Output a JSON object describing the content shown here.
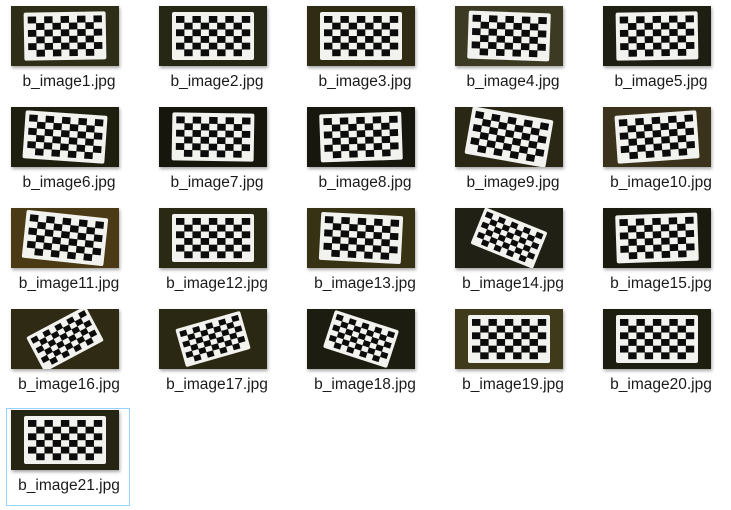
{
  "files": [
    {
      "name": "b_image1.jpg",
      "icon": "checkerboard-thumbnail-icon",
      "bg": "#2e2d17",
      "tilt": -1,
      "selected": false
    },
    {
      "name": "b_image2.jpg",
      "icon": "checkerboard-thumbnail-icon",
      "bg": "#272716",
      "tilt": 0,
      "selected": false
    },
    {
      "name": "b_image3.jpg",
      "icon": "checkerboard-thumbnail-icon",
      "bg": "#302c14",
      "tilt": 0,
      "selected": false
    },
    {
      "name": "b_image4.jpg",
      "icon": "checkerboard-thumbnail-icon",
      "bg": "#3c3a22",
      "tilt": 2,
      "selected": false
    },
    {
      "name": "b_image5.jpg",
      "icon": "checkerboard-thumbnail-icon",
      "bg": "#1e1e12",
      "tilt": -1,
      "selected": false
    },
    {
      "name": "b_image6.jpg",
      "icon": "checkerboard-thumbnail-icon",
      "bg": "#1f1f10",
      "tilt": 4,
      "selected": false
    },
    {
      "name": "b_image7.jpg",
      "icon": "checkerboard-thumbnail-icon",
      "bg": "#16160c",
      "tilt": 1,
      "selected": false
    },
    {
      "name": "b_image8.jpg",
      "icon": "checkerboard-thumbnail-icon",
      "bg": "#18170e",
      "tilt": -2,
      "selected": false
    },
    {
      "name": "b_image9.jpg",
      "icon": "checkerboard-thumbnail-icon",
      "bg": "#2a2814",
      "tilt": 10,
      "selected": false
    },
    {
      "name": "b_image10.jpg",
      "icon": "checkerboard-thumbnail-icon",
      "bg": "#3a321a",
      "tilt": -4,
      "selected": false
    },
    {
      "name": "b_image11.jpg",
      "icon": "checkerboard-thumbnail-icon",
      "bg": "#4a3a16",
      "tilt": 6,
      "selected": false
    },
    {
      "name": "b_image12.jpg",
      "icon": "checkerboard-thumbnail-icon",
      "bg": "#2a2a14",
      "tilt": 0,
      "selected": false
    },
    {
      "name": "b_image13.jpg",
      "icon": "checkerboard-thumbnail-icon",
      "bg": "#383214",
      "tilt": 3,
      "selected": false
    },
    {
      "name": "b_image14.jpg",
      "icon": "checkerboard-thumbnail-icon",
      "bg": "#202014",
      "tilt": 22,
      "selected": false
    },
    {
      "name": "b_image15.jpg",
      "icon": "checkerboard-thumbnail-icon",
      "bg": "#1a1a0e",
      "tilt": -2,
      "selected": false
    },
    {
      "name": "b_image16.jpg",
      "icon": "checkerboard-thumbnail-icon",
      "bg": "#2e2a14",
      "tilt": -28,
      "selected": false
    },
    {
      "name": "b_image17.jpg",
      "icon": "checkerboard-thumbnail-icon",
      "bg": "#2a2812",
      "tilt": -16,
      "selected": false
    },
    {
      "name": "b_image18.jpg",
      "icon": "checkerboard-thumbnail-icon",
      "bg": "#1c1c10",
      "tilt": 18,
      "selected": false
    },
    {
      "name": "b_image19.jpg",
      "icon": "checkerboard-thumbnail-icon",
      "bg": "#3e3a1a",
      "tilt": 0,
      "selected": false
    },
    {
      "name": "b_image20.jpg",
      "icon": "checkerboard-thumbnail-icon",
      "bg": "#1e1e10",
      "tilt": 0,
      "selected": false
    },
    {
      "name": "b_image21.jpg",
      "icon": "checkerboard-thumbnail-icon",
      "bg": "#262412",
      "tilt": 0,
      "selected": true
    }
  ],
  "colors": {
    "selection_border": "#99d1ff",
    "label_text": "#1a1a1a",
    "board_white": "#f2f2ee",
    "board_black": "#0c0c0c"
  }
}
